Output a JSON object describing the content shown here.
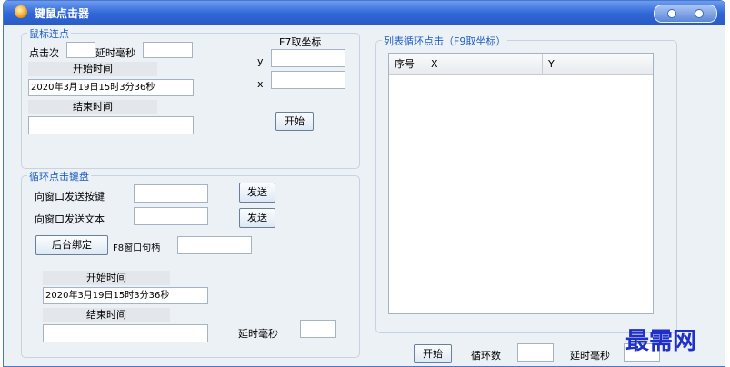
{
  "window": {
    "title": "键鼠点击器"
  },
  "mouse_group": {
    "legend": "鼠标连点",
    "click_count_label": "点击次",
    "delay_ms_label": "延时毫秒",
    "f7_label": "F7取坐标",
    "y_label": "y",
    "x_label": "x",
    "start_time_label": "开始时间",
    "start_time_value": "2020年3月19日15时3分36秒",
    "end_time_label": "结束时间",
    "start_button": "开始"
  },
  "keyboard_group": {
    "legend": "循环点击键盘",
    "send_key_label": "向窗口发送按键",
    "send_text_label": "向窗口发送文本",
    "send_button": "发送",
    "bind_button": "后台绑定",
    "f8_label": "F8窗口句柄",
    "start_time_label": "开始时间",
    "start_time_value": "2020年3月19日15时3分36秒",
    "end_time_label": "结束时间",
    "delay_ms_label": "延时毫秒"
  },
  "list_group": {
    "legend": "列表循环点击（F9取坐标）",
    "columns": [
      "序号",
      "X",
      "Y"
    ],
    "start_button": "开始",
    "loop_count_label": "循环数",
    "delay_ms_label": "延时毫秒"
  },
  "watermark": "最需网"
}
